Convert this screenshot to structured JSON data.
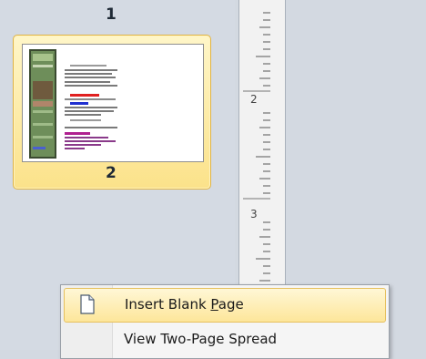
{
  "pages": [
    {
      "number": "1"
    },
    {
      "number": "2",
      "selected": true
    }
  ],
  "ruler": {
    "labels": [
      "2",
      "3"
    ]
  },
  "context_menu": {
    "items": [
      {
        "label_before": "Insert Blank ",
        "mnemonic": "P",
        "label_after": "age",
        "highlighted": true,
        "icon": "blank-page-icon"
      },
      {
        "label_before": "View Two-Page Spread",
        "mnemonic": "",
        "label_after": "",
        "highlighted": false
      }
    ]
  },
  "colors": {
    "selection_fill": "#fbe28a",
    "selection_border": "#e0b344",
    "pane_background": "#d4dae3",
    "ruler_background": "#f2f2f2"
  }
}
